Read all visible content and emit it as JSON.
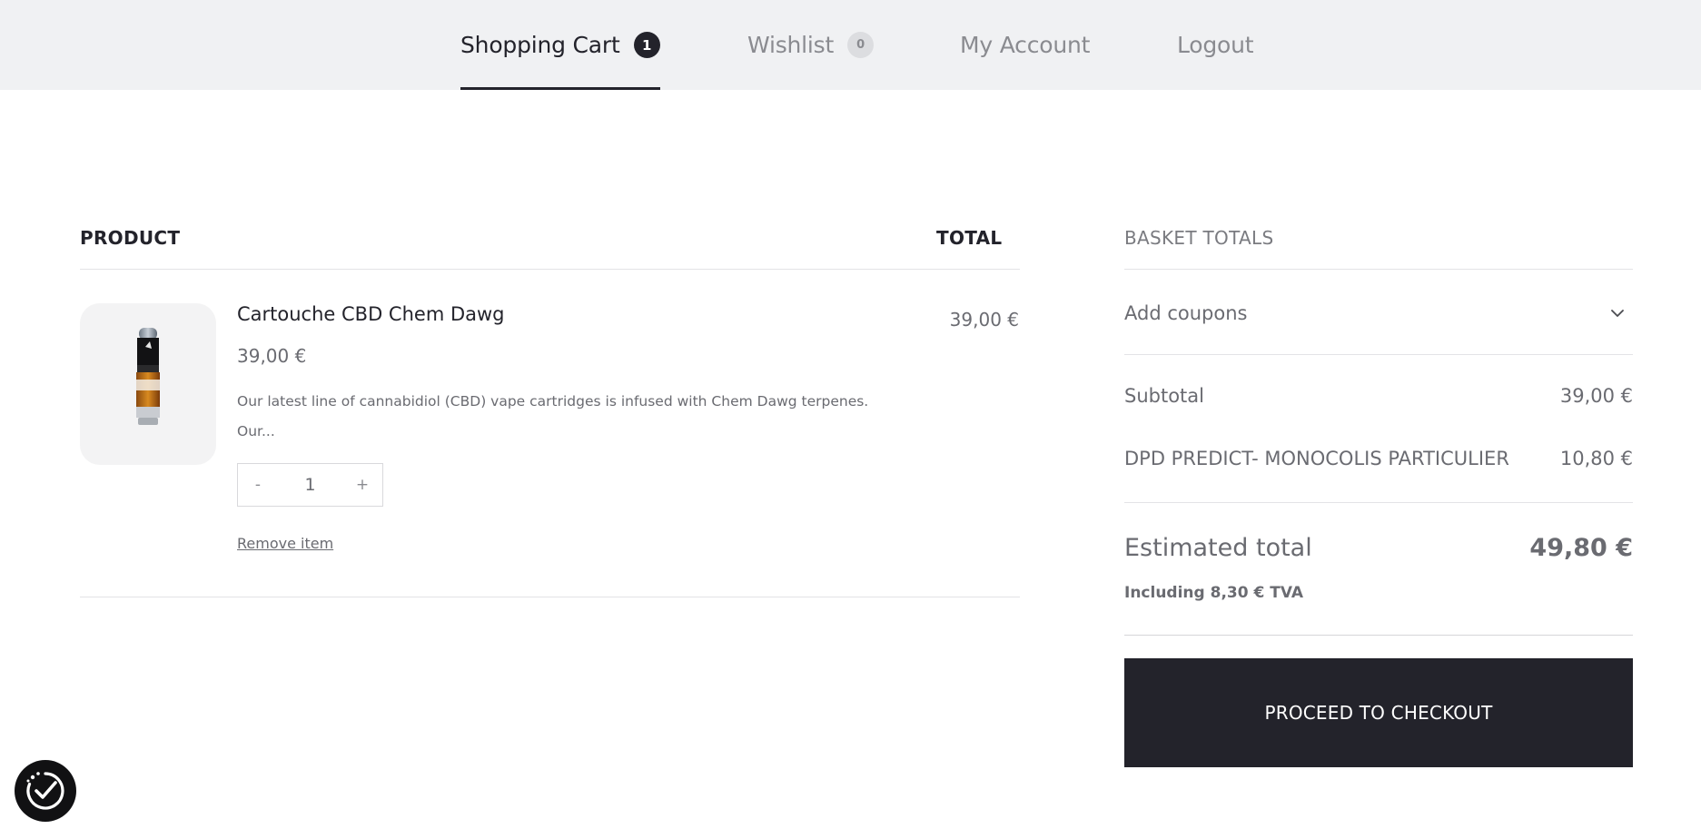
{
  "nav": {
    "tabs": [
      {
        "label": "Shopping Cart",
        "badge": "1",
        "active": true
      },
      {
        "label": "Wishlist",
        "badge": "0",
        "active": false
      },
      {
        "label": "My Account"
      },
      {
        "label": "Logout"
      }
    ]
  },
  "cart": {
    "headers": {
      "product": "PRODUCT",
      "total": "TOTAL"
    },
    "items": [
      {
        "name": "Cartouche CBD Chem Dawg",
        "price": "39,00 €",
        "description": "Our latest line of cannabidiol (CBD) vape cartridges is infused with Chem Dawg terpenes. Our...",
        "quantity": "1",
        "total": "39,00 €",
        "remove_label": "Remove item",
        "qty_decrease": "-",
        "qty_increase": "+",
        "image_icon": "vape-cartridge-image"
      }
    ]
  },
  "totals": {
    "title": "BASKET TOTALS",
    "coupon_label": "Add coupons",
    "subtotal_label": "Subtotal",
    "subtotal_value": "39,00 €",
    "shipping_label": "DPD PREDICT- MONOCOLIS PARTICULIER",
    "shipping_value": "10,80 €",
    "estimated_label": "Estimated total",
    "estimated_value": "49,80 €",
    "tax_note": "Including 8,30 € TVA",
    "checkout_label": "PROCEED TO CHECKOUT"
  },
  "colors": {
    "topbar_bg": "#f0f1f3",
    "primary_dark": "#23232b",
    "muted_text": "#6a6b71"
  },
  "widgets": {
    "accessibility_icon": "accessibility-check-icon"
  }
}
